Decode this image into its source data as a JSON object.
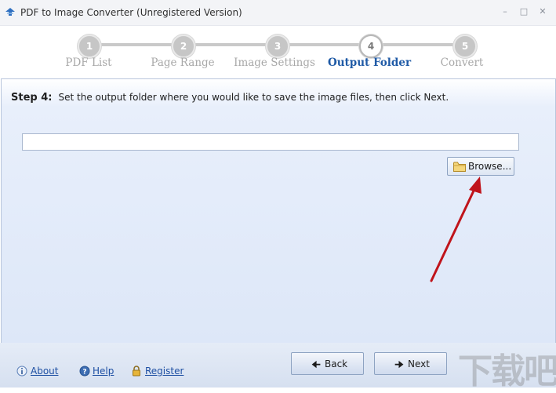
{
  "window": {
    "title": "PDF to Image Converter (Unregistered Version)",
    "icon": "app-logo-icon",
    "controls": [
      "minimize-icon",
      "maximize-icon",
      "close-icon"
    ]
  },
  "steps": [
    {
      "number": "1",
      "label": "PDF List",
      "state": "inactive"
    },
    {
      "number": "2",
      "label": "Page Range",
      "state": "inactive"
    },
    {
      "number": "3",
      "label": "Image Settings",
      "state": "inactive"
    },
    {
      "number": "4",
      "label": "Output Folder",
      "state": "active"
    },
    {
      "number": "5",
      "label": "Convert",
      "state": "inactive"
    }
  ],
  "main": {
    "step_title": "Step 4:",
    "instruction": "Set the output folder where you would like to save the image files, then click Next.",
    "output_path": "",
    "browse_label": "Browse..."
  },
  "footer": {
    "about_label": "About",
    "help_label": "Help",
    "register_label": "Register",
    "back_label": "Back",
    "next_label": "Next"
  },
  "watermark": "下载吧",
  "colors": {
    "accent": "#1f5aa6",
    "content_bg": "#dde7f8",
    "annotation_arrow": "#c0141b"
  }
}
